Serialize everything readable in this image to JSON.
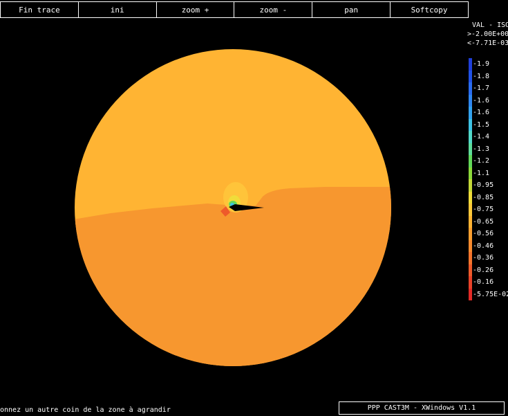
{
  "toolbar": {
    "buttons": [
      "Fin trace",
      "ini",
      "zoom +",
      "zoom -",
      "pan",
      "Softcopy"
    ]
  },
  "legend": {
    "title": "VAL - ISO",
    "max_line": ">-2.00E+00",
    "min_line": "<-7.71E-03",
    "entries": [
      {
        "label": "-1.9",
        "color": "#1f3fd8"
      },
      {
        "label": "-1.8",
        "color": "#2052e6"
      },
      {
        "label": "-1.7",
        "color": "#2a6cf0"
      },
      {
        "label": "-1.6",
        "color": "#2f86f0"
      },
      {
        "label": "-1.6",
        "color": "#33a2ee"
      },
      {
        "label": "-1.5",
        "color": "#3ec2e4"
      },
      {
        "label": "-1.4",
        "color": "#52d8c8"
      },
      {
        "label": "-1.3",
        "color": "#5edc9a"
      },
      {
        "label": "-1.2",
        "color": "#62d85a"
      },
      {
        "label": "-1.1",
        "color": "#8cd83a"
      },
      {
        "label": "-0.95",
        "color": "#c4d838"
      },
      {
        "label": "-0.85",
        "color": "#f0dc3a"
      },
      {
        "label": "-0.75",
        "color": "#fcc83a"
      },
      {
        "label": "-0.65",
        "color": "#ffb433"
      },
      {
        "label": "-0.56",
        "color": "#fca030"
      },
      {
        "label": "-0.46",
        "color": "#f88a2e"
      },
      {
        "label": "-0.36",
        "color": "#f4742c"
      },
      {
        "label": "-0.26",
        "color": "#ee5a2a"
      },
      {
        "label": "-0.16",
        "color": "#e84228"
      },
      {
        "label": "-5.75E-02",
        "color": "#e22a26"
      }
    ]
  },
  "plot": {
    "upper_color": "#ffb433",
    "lower_color": "#f7972f",
    "blob_color": "#ffc43a",
    "blob_inner_color": "#f0dc3a",
    "green_color": "#62d85a",
    "cyan_color": "#3ec2e4",
    "red_color": "#ee5a2a",
    "crack_color": "#000000"
  },
  "status": {
    "message": "onnez un autre coin de la zone à agrandir",
    "app_title": "PPP CAST3M - XWindows V1.1"
  }
}
